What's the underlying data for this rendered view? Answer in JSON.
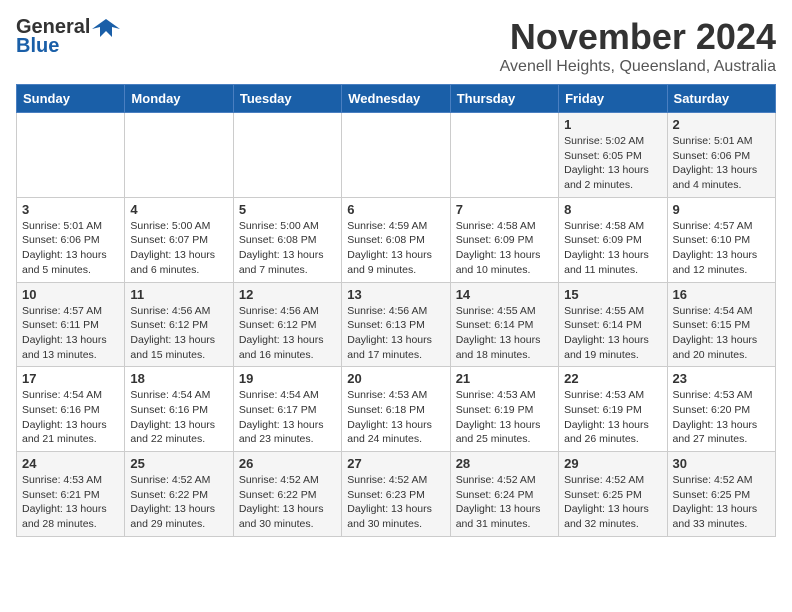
{
  "logo": {
    "line1": "General",
    "line2": "Blue"
  },
  "header": {
    "month": "November 2024",
    "location": "Avenell Heights, Queensland, Australia"
  },
  "weekdays": [
    "Sunday",
    "Monday",
    "Tuesday",
    "Wednesday",
    "Thursday",
    "Friday",
    "Saturday"
  ],
  "weeks": [
    [
      {
        "day": "",
        "detail": ""
      },
      {
        "day": "",
        "detail": ""
      },
      {
        "day": "",
        "detail": ""
      },
      {
        "day": "",
        "detail": ""
      },
      {
        "day": "",
        "detail": ""
      },
      {
        "day": "1",
        "detail": "Sunrise: 5:02 AM\nSunset: 6:05 PM\nDaylight: 13 hours and 2 minutes."
      },
      {
        "day": "2",
        "detail": "Sunrise: 5:01 AM\nSunset: 6:06 PM\nDaylight: 13 hours and 4 minutes."
      }
    ],
    [
      {
        "day": "3",
        "detail": "Sunrise: 5:01 AM\nSunset: 6:06 PM\nDaylight: 13 hours and 5 minutes."
      },
      {
        "day": "4",
        "detail": "Sunrise: 5:00 AM\nSunset: 6:07 PM\nDaylight: 13 hours and 6 minutes."
      },
      {
        "day": "5",
        "detail": "Sunrise: 5:00 AM\nSunset: 6:08 PM\nDaylight: 13 hours and 7 minutes."
      },
      {
        "day": "6",
        "detail": "Sunrise: 4:59 AM\nSunset: 6:08 PM\nDaylight: 13 hours and 9 minutes."
      },
      {
        "day": "7",
        "detail": "Sunrise: 4:58 AM\nSunset: 6:09 PM\nDaylight: 13 hours and 10 minutes."
      },
      {
        "day": "8",
        "detail": "Sunrise: 4:58 AM\nSunset: 6:09 PM\nDaylight: 13 hours and 11 minutes."
      },
      {
        "day": "9",
        "detail": "Sunrise: 4:57 AM\nSunset: 6:10 PM\nDaylight: 13 hours and 12 minutes."
      }
    ],
    [
      {
        "day": "10",
        "detail": "Sunrise: 4:57 AM\nSunset: 6:11 PM\nDaylight: 13 hours and 13 minutes."
      },
      {
        "day": "11",
        "detail": "Sunrise: 4:56 AM\nSunset: 6:12 PM\nDaylight: 13 hours and 15 minutes."
      },
      {
        "day": "12",
        "detail": "Sunrise: 4:56 AM\nSunset: 6:12 PM\nDaylight: 13 hours and 16 minutes."
      },
      {
        "day": "13",
        "detail": "Sunrise: 4:56 AM\nSunset: 6:13 PM\nDaylight: 13 hours and 17 minutes."
      },
      {
        "day": "14",
        "detail": "Sunrise: 4:55 AM\nSunset: 6:14 PM\nDaylight: 13 hours and 18 minutes."
      },
      {
        "day": "15",
        "detail": "Sunrise: 4:55 AM\nSunset: 6:14 PM\nDaylight: 13 hours and 19 minutes."
      },
      {
        "day": "16",
        "detail": "Sunrise: 4:54 AM\nSunset: 6:15 PM\nDaylight: 13 hours and 20 minutes."
      }
    ],
    [
      {
        "day": "17",
        "detail": "Sunrise: 4:54 AM\nSunset: 6:16 PM\nDaylight: 13 hours and 21 minutes."
      },
      {
        "day": "18",
        "detail": "Sunrise: 4:54 AM\nSunset: 6:16 PM\nDaylight: 13 hours and 22 minutes."
      },
      {
        "day": "19",
        "detail": "Sunrise: 4:54 AM\nSunset: 6:17 PM\nDaylight: 13 hours and 23 minutes."
      },
      {
        "day": "20",
        "detail": "Sunrise: 4:53 AM\nSunset: 6:18 PM\nDaylight: 13 hours and 24 minutes."
      },
      {
        "day": "21",
        "detail": "Sunrise: 4:53 AM\nSunset: 6:19 PM\nDaylight: 13 hours and 25 minutes."
      },
      {
        "day": "22",
        "detail": "Sunrise: 4:53 AM\nSunset: 6:19 PM\nDaylight: 13 hours and 26 minutes."
      },
      {
        "day": "23",
        "detail": "Sunrise: 4:53 AM\nSunset: 6:20 PM\nDaylight: 13 hours and 27 minutes."
      }
    ],
    [
      {
        "day": "24",
        "detail": "Sunrise: 4:53 AM\nSunset: 6:21 PM\nDaylight: 13 hours and 28 minutes."
      },
      {
        "day": "25",
        "detail": "Sunrise: 4:52 AM\nSunset: 6:22 PM\nDaylight: 13 hours and 29 minutes."
      },
      {
        "day": "26",
        "detail": "Sunrise: 4:52 AM\nSunset: 6:22 PM\nDaylight: 13 hours and 30 minutes."
      },
      {
        "day": "27",
        "detail": "Sunrise: 4:52 AM\nSunset: 6:23 PM\nDaylight: 13 hours and 30 minutes."
      },
      {
        "day": "28",
        "detail": "Sunrise: 4:52 AM\nSunset: 6:24 PM\nDaylight: 13 hours and 31 minutes."
      },
      {
        "day": "29",
        "detail": "Sunrise: 4:52 AM\nSunset: 6:25 PM\nDaylight: 13 hours and 32 minutes."
      },
      {
        "day": "30",
        "detail": "Sunrise: 4:52 AM\nSunset: 6:25 PM\nDaylight: 13 hours and 33 minutes."
      }
    ]
  ]
}
